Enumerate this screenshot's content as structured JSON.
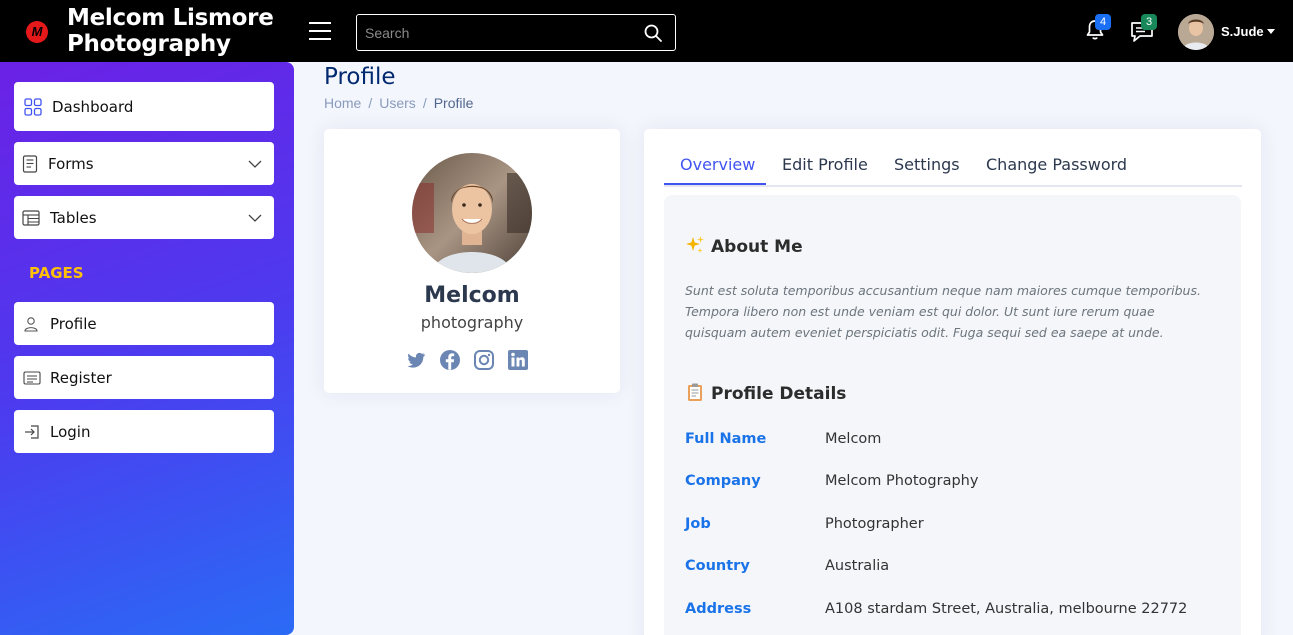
{
  "brand": {
    "logo_letter": "M",
    "title": "Melcom Lismore Photography"
  },
  "search": {
    "placeholder": "Search"
  },
  "notifications": {
    "count": "4"
  },
  "messages": {
    "count": "3"
  },
  "user": {
    "name": "S.Jude"
  },
  "sidebar": {
    "items": [
      {
        "label": "Dashboard",
        "icon": "grid-icon"
      },
      {
        "label": "Forms",
        "icon": "form-icon",
        "expandable": true
      },
      {
        "label": "Tables",
        "icon": "table-icon",
        "expandable": true
      }
    ],
    "section_heading": "PAGES",
    "pages": [
      {
        "label": "Profile",
        "icon": "person-icon"
      },
      {
        "label": "Register",
        "icon": "card-icon"
      },
      {
        "label": "Login",
        "icon": "login-icon"
      }
    ]
  },
  "page": {
    "title": "Profile",
    "breadcrumb": [
      "Home",
      "Users",
      "Profile"
    ]
  },
  "profile": {
    "name": "Melcom",
    "subtitle": "photography",
    "socials": [
      "twitter-icon",
      "facebook-icon",
      "instagram-icon",
      "linkedin-icon"
    ]
  },
  "tabs": [
    "Overview",
    "Edit Profile",
    "Settings",
    "Change Password"
  ],
  "overview": {
    "about_title": "About Me",
    "about_text": "Sunt est soluta temporibus accusantium neque nam maiores cumque temporibus. Tempora libero non est unde veniam est qui dolor. Ut sunt iure rerum quae quisquam autem eveniet perspiciatis odit. Fuga sequi sed ea saepe at unde.",
    "details_title": "Profile Details",
    "details": [
      {
        "label": "Full Name",
        "value": "Melcom"
      },
      {
        "label": "Company",
        "value": "Melcom Photography"
      },
      {
        "label": "Job",
        "value": "Photographer"
      },
      {
        "label": "Country",
        "value": "Australia"
      },
      {
        "label": "Address",
        "value": "A108 stardam Street, Australia, melbourne 22772"
      }
    ]
  },
  "colors": {
    "sidebar_gradient": [
      "#6b21e6",
      "#2a6bf5"
    ],
    "accent": "#4154f1",
    "label_blue": "#1a73e8",
    "section_yellow": "#ffc107"
  }
}
